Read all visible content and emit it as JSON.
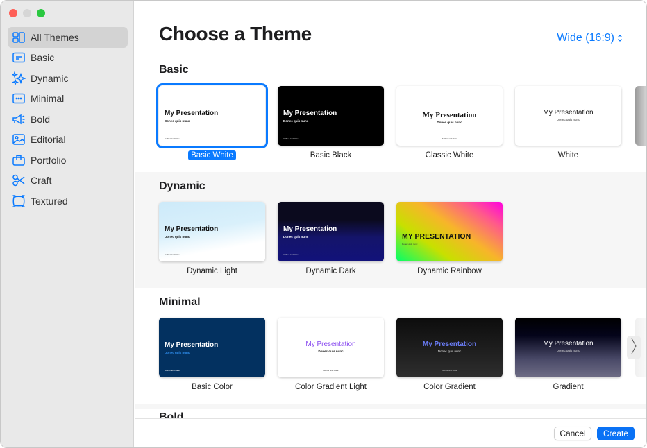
{
  "window": {
    "traffic_lights": [
      "close",
      "minimize",
      "zoom"
    ]
  },
  "sidebar": {
    "items": [
      {
        "label": "All Themes",
        "icon": "grid-icon",
        "active": true
      },
      {
        "label": "Basic",
        "icon": "basic-icon",
        "active": false
      },
      {
        "label": "Dynamic",
        "icon": "sparkles-icon",
        "active": false
      },
      {
        "label": "Minimal",
        "icon": "ellipsis-rect-icon",
        "active": false
      },
      {
        "label": "Bold",
        "icon": "megaphone-icon",
        "active": false
      },
      {
        "label": "Editorial",
        "icon": "photo-icon",
        "active": false
      },
      {
        "label": "Portfolio",
        "icon": "briefcase-icon",
        "active": false
      },
      {
        "label": "Craft",
        "icon": "scissors-icon",
        "active": false
      },
      {
        "label": "Textured",
        "icon": "textured-frame-icon",
        "active": false
      }
    ]
  },
  "header": {
    "title": "Choose a Theme",
    "aspect_ratio": "Wide (16:9)"
  },
  "sections": [
    {
      "title": "Basic",
      "themes": [
        {
          "name": "Basic White",
          "selected": true,
          "title": "My Presentation",
          "subtitle": "Donec quis nunc",
          "footer": "Author and Date"
        },
        {
          "name": "Basic Black",
          "selected": false,
          "title": "My Presentation",
          "subtitle": "Donec quis nunc",
          "footer": "Author and Date"
        },
        {
          "name": "Classic White",
          "selected": false,
          "title": "My Presentation",
          "subtitle": "Donec quis nunc",
          "footer": "Author and Date"
        },
        {
          "name": "White",
          "selected": false,
          "title": "My Presentation",
          "subtitle": "Donec quis nunc",
          "footer": ""
        }
      ]
    },
    {
      "title": "Dynamic",
      "themes": [
        {
          "name": "Dynamic Light",
          "selected": false,
          "title": "My Presentation",
          "subtitle": "Donec quis nunc",
          "footer": "Author and Date"
        },
        {
          "name": "Dynamic Dark",
          "selected": false,
          "title": "My Presentation",
          "subtitle": "Donec quis nunc",
          "footer": "Author and Date"
        },
        {
          "name": "Dynamic Rainbow",
          "selected": false,
          "title": "MY PRESENTATION",
          "subtitle": "Donec quis nunc",
          "footer": ""
        }
      ]
    },
    {
      "title": "Minimal",
      "themes": [
        {
          "name": "Basic Color",
          "selected": false,
          "title": "My Presentation",
          "subtitle": "Donec quis nunc",
          "footer": "Author and Date"
        },
        {
          "name": "Color Gradient Light",
          "selected": false,
          "title": "My Presentation",
          "subtitle": "Donec quis nunc",
          "footer": "Author and Date"
        },
        {
          "name": "Color Gradient",
          "selected": false,
          "title": "My Presentation",
          "subtitle": "Donec quis nunc",
          "footer": "Author and Date"
        },
        {
          "name": "Gradient",
          "selected": false,
          "title": "My Presentation",
          "subtitle": "Donec quis nunc",
          "footer": ""
        }
      ]
    },
    {
      "title": "Bold",
      "themes": []
    }
  ],
  "footer": {
    "cancel_label": "Cancel",
    "create_label": "Create"
  },
  "colors": {
    "accent": "#0a7aff",
    "sidebar_bg": "#e9e9e9",
    "create_button": "#0a72f5"
  }
}
